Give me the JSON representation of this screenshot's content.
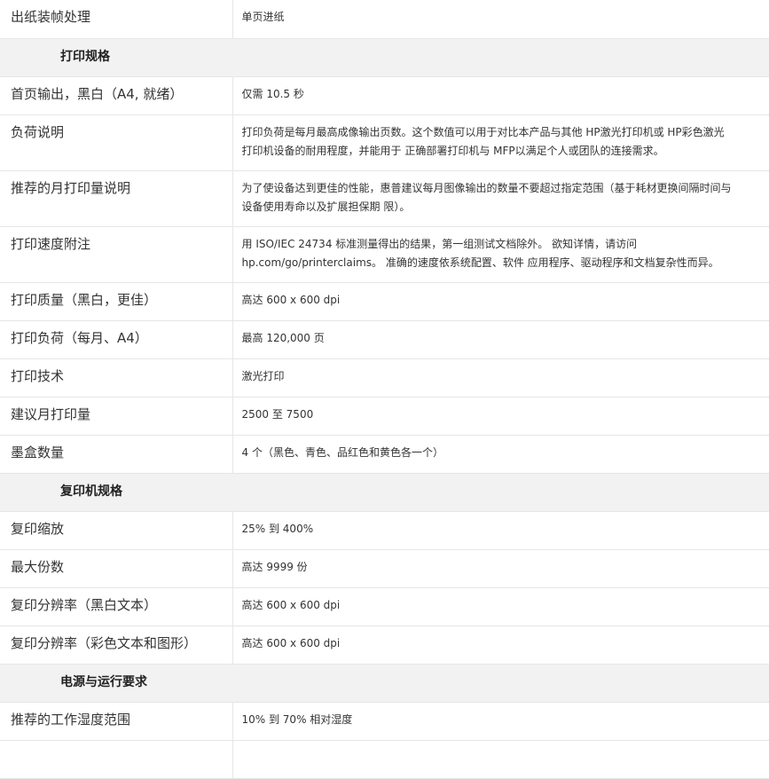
{
  "rows": [
    {
      "type": "row",
      "label": "出纸装帧处理",
      "value": "单页进纸",
      "h": 43
    },
    {
      "type": "section",
      "label": "打印规格"
    },
    {
      "type": "row",
      "label": "首页输出，黑白（A4, 就绪）",
      "value": "仅需 10.5 秒",
      "h": 43
    },
    {
      "type": "row",
      "label": "负荷说明",
      "value": "打印负荷是每月最高成像输出页数。这个数值可以用于对比本产品与其他 HP激光打印机或 HP彩色激光打印机设备的耐用程度，并能用于 正确部署打印机与 MFP以满足个人或团队的连接需求。",
      "h": 63
    },
    {
      "type": "row",
      "label": "推荐的月打印量说明",
      "value": "为了使设备达到更佳的性能，惠普建议每月图像输出的数量不要超过指定范围（基于耗材更换间隔时间与设备使用寿命以及扩展担保期 限）。",
      "h": 63
    },
    {
      "type": "row",
      "label": "打印速度附注",
      "value": "用 ISO/IEC 24734 标准测量得出的结果，第一组测试文档除外。 欲知详情，请访问 hp.com/go/printerclaims。 准确的速度依系统配置、软件 应用程序、驱动程序和文档复杂性而异。",
      "h": 63
    },
    {
      "type": "row",
      "label": "打印质量（黑白，更佳）",
      "value": "高达 600 x 600 dpi",
      "h": 43
    },
    {
      "type": "row",
      "label": "打印负荷（每月、A4）",
      "value": "最高 120,000 页",
      "h": 43
    },
    {
      "type": "row",
      "label": "打印技术",
      "value": "激光打印",
      "h": 43
    },
    {
      "type": "row",
      "label": "建议月打印量",
      "value": "2500 至 7500",
      "h": 43
    },
    {
      "type": "row",
      "label": "墨盒数量",
      "value": "4 个（黑色、青色、品红色和黄色各一个）",
      "h": 43
    },
    {
      "type": "section",
      "label": "复印机规格"
    },
    {
      "type": "row",
      "label": "复印缩放",
      "value": "25% 到 400%",
      "h": 43
    },
    {
      "type": "row",
      "label": "最大份数",
      "value": "高达 9999 份",
      "h": 43
    },
    {
      "type": "row",
      "label": "复印分辨率（黑白文本）",
      "value": "高达 600 x 600 dpi",
      "h": 43
    },
    {
      "type": "row",
      "label": "复印分辨率（彩色文本和图形）",
      "value": "高达 600 x 600 dpi",
      "h": 43
    },
    {
      "type": "section",
      "label": "电源与运行要求"
    },
    {
      "type": "row",
      "label": "推荐的工作湿度范围",
      "value": "10% 到 70% 相对湿度",
      "h": 43
    },
    {
      "type": "row",
      "label": "",
      "value": "",
      "h": 43
    }
  ]
}
